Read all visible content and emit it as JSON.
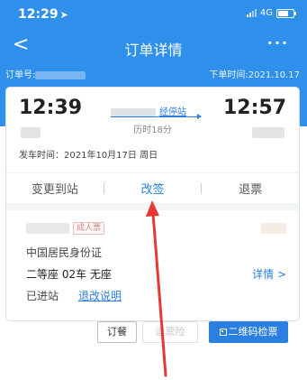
{
  "status_bar": {
    "time": "12:29",
    "network": "4G"
  },
  "nav": {
    "title": "订单详情",
    "back": "<",
    "more": "···"
  },
  "order": {
    "number_label": "订单号:",
    "time_label": "下单时间:2021.10.17"
  },
  "trip": {
    "depart_time": "12:39",
    "arrive_time": "12:57",
    "stop_link": "经停站",
    "duration": "历时18分",
    "depart_date": "发车时间：2021年10月17日 周日"
  },
  "actions": {
    "change_station": "变更到站",
    "reschedule": "改签",
    "refund": "退票"
  },
  "passenger": {
    "badge": "成人票",
    "id_type": "中国居民身份证",
    "seat": "二等座 02车 无座",
    "detail": "详情 >",
    "status": "已进站",
    "refund_note": "退改说明"
  },
  "buttons": {
    "meal": "订餐",
    "insurance": "退票险",
    "qr": "二维码检票"
  },
  "colors": {
    "accent": "#2f90ec",
    "link": "#2a7fe0",
    "annotation": "#e53935"
  }
}
